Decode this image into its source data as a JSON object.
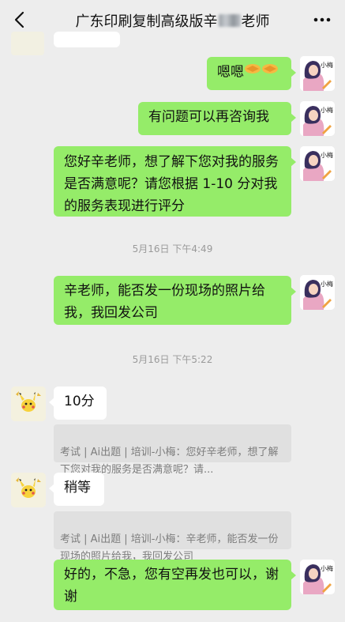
{
  "header": {
    "title_prefix": "广东印刷复制高级版辛",
    "title_suffix": "老师",
    "back_icon": "chevron-left-icon",
    "more_icon": "more-dots-icon"
  },
  "contacts": {
    "self_avatar_label": "小梅"
  },
  "messages": [
    {
      "text": "嗯嗯",
      "emoji": "handshake"
    },
    {
      "text": "有问题可以再咨询我"
    },
    {
      "text": "您好辛老师，想了解下您对我的服务是否满意呢？请您根据 1-10 分对我的服务表现进行评分"
    },
    {
      "text": "辛老师，能否发一份现场的照片给我，我回发公司"
    },
    {
      "text": "10分"
    },
    {
      "text": "稍等"
    },
    {
      "text": "好的，不急，您有空再发也可以，谢谢"
    }
  ],
  "timestamps": [
    "5月16日 下午4:49",
    "5月16日 下午5:22"
  ],
  "quotes": [
    "考试 | Ai出题 | 培训-小梅：您好辛老师，想了解下您对我的服务是否满意呢？请...",
    "考试 | Ai出题 | 培训-小梅：辛老师，能否发一份现场的照片给我，我回发公司"
  ],
  "colors": {
    "background": "#ededed",
    "self_bubble": "#95ec69",
    "other_bubble": "#ffffff",
    "quote_bg": "#e0e0e0",
    "timestamp_text": "#9a9a9a"
  }
}
